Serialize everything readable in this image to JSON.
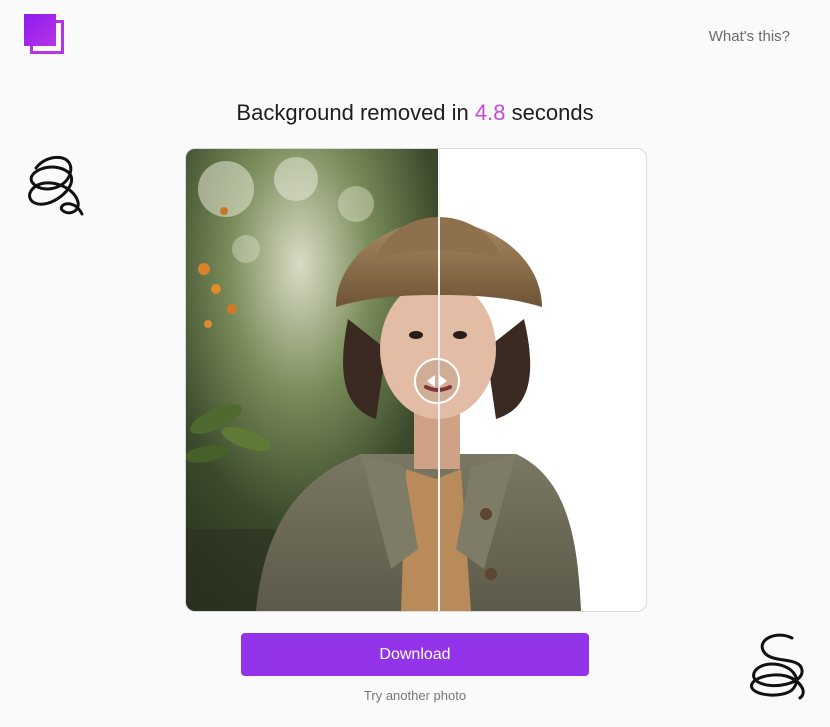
{
  "header": {
    "help_link": "What's this?"
  },
  "headline": {
    "prefix": "Background removed in",
    "seconds": "4.8",
    "suffix": "seconds"
  },
  "actions": {
    "download_label": "Download",
    "try_another_label": "Try another photo"
  },
  "colors": {
    "accent": "#9333ea",
    "highlight": "#c44bd1"
  },
  "comparison": {
    "slider_position": 0.55
  },
  "icons": [
    "app-logo-icon",
    "compare-arrows-icon"
  ]
}
